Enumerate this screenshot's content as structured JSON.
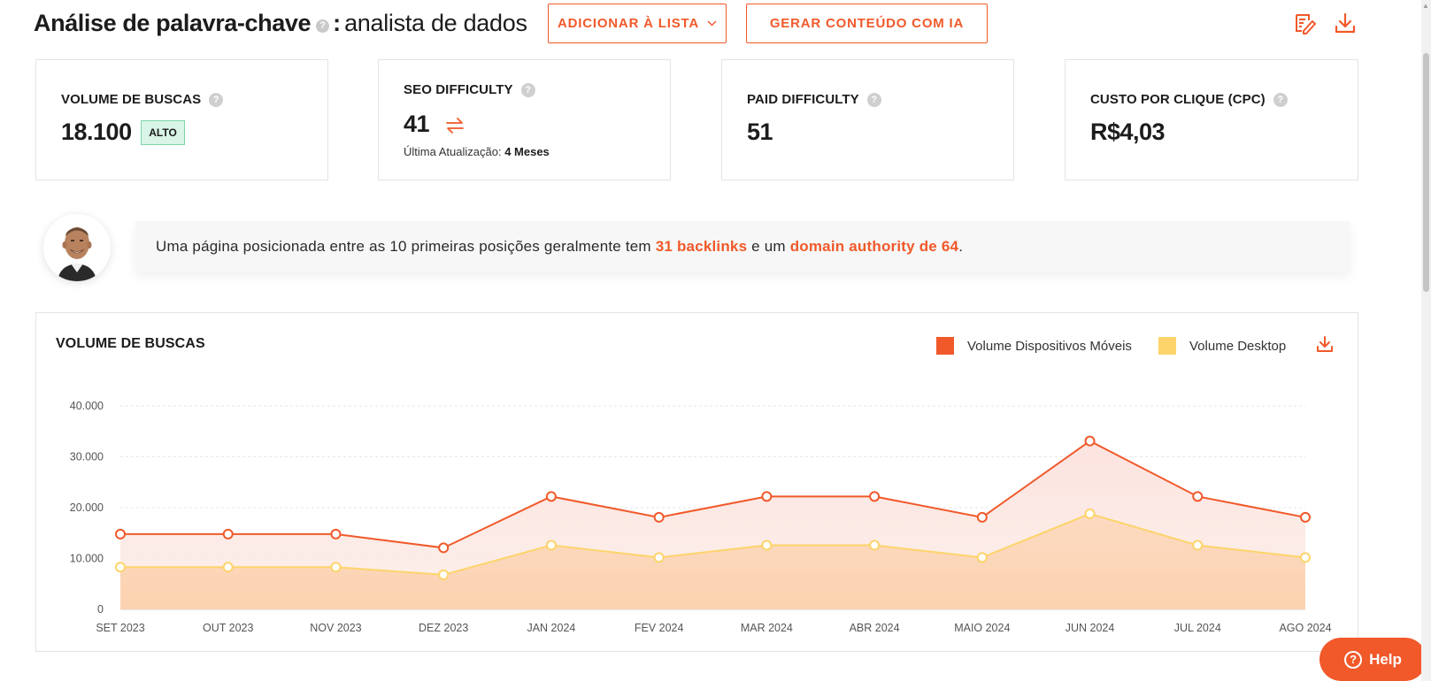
{
  "header": {
    "title": "Análise de palavra-chave",
    "help_glyph": "?",
    "colon": ":",
    "keyword": "analista de dados",
    "add_to_list_label": "ADICIONAR À LISTA",
    "generate_label": "GERAR CONTEÚDO COM IA",
    "icons": [
      "edit-report-icon",
      "download-icon",
      "chevron-down-icon"
    ]
  },
  "cards": {
    "search_volume": {
      "label": "VOLUME DE BUSCAS",
      "value": "18.100",
      "badge": "ALTO"
    },
    "seo_difficulty": {
      "label": "SEO DIFFICULTY",
      "value": "41",
      "updated_label": "Última Atualização:",
      "updated_value": "4 Meses"
    },
    "paid_difficulty": {
      "label": "PAID DIFFICULTY",
      "value": "51"
    },
    "cpc": {
      "label": "CUSTO POR CLIQUE (CPC)",
      "value": "R$4,03"
    }
  },
  "banner": {
    "text_before": "Uma página posicionada entre as 10 primeiras posições geralmente tem ",
    "backlinks": "31 backlinks",
    "text_middle": " e um ",
    "authority": "domain authority de 64",
    "text_after": "."
  },
  "help_button": {
    "label": "Help",
    "glyph": "?"
  },
  "colors": {
    "accent": "#f1592a",
    "mobile": "#f1592a",
    "desktop": "#fdd46a",
    "badge_bg": "#d8f5e7"
  },
  "chart_data": {
    "type": "area",
    "title": "VOLUME DE BUSCAS",
    "xlabel": "",
    "ylabel": "",
    "ylim": [
      0,
      40000
    ],
    "yticks": [
      "0",
      "10.000",
      "20.000",
      "30.000",
      "40.000"
    ],
    "categories": [
      "SET 2023",
      "OUT 2023",
      "NOV 2023",
      "DEZ 2023",
      "JAN 2024",
      "FEV 2024",
      "MAR 2024",
      "ABR 2024",
      "MAIO 2024",
      "JUN 2024",
      "JUL 2024",
      "AGO 2024"
    ],
    "series": [
      {
        "name": "Volume Dispositivos Móveis",
        "color": "#f1592a",
        "values": [
          14800,
          14800,
          14800,
          12100,
          22200,
          18100,
          22200,
          22200,
          18100,
          33100,
          22200,
          18100
        ]
      },
      {
        "name": "Volume Desktop",
        "color": "#fdd46a",
        "values": [
          8300,
          8300,
          8300,
          6800,
          12600,
          10200,
          12600,
          12600,
          10200,
          18800,
          12600,
          10200
        ]
      }
    ],
    "grid": true,
    "legend": "top-right"
  }
}
